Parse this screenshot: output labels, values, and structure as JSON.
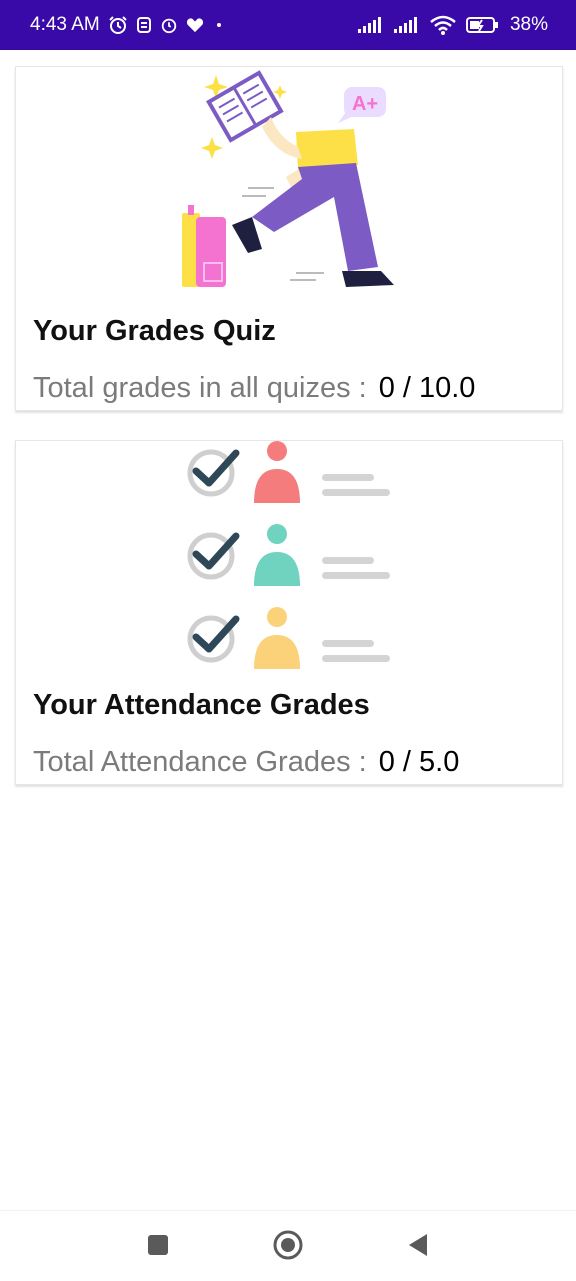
{
  "status_bar": {
    "time": "4:43 AM",
    "battery": "38%",
    "icons": [
      "alarm-icon",
      "notification-icon",
      "alarm-clock-icon",
      "heart-icon",
      "dot-icon",
      "signal-icon",
      "signal-icon",
      "wifi-icon",
      "battery-charging-icon"
    ]
  },
  "quiz_card": {
    "title": "Your Grades Quiz",
    "total_label": "Total grades in all quizes :",
    "total_value": "0 / 10.0",
    "illustration": "student-studying-illustration",
    "badge": "A+"
  },
  "attendance_card": {
    "title": "Your Attendance Grades",
    "total_label": "Total Attendance Grades :",
    "total_value": "0 / 5.0",
    "illustration": "attendance-checklist-illustration"
  },
  "nav_bar": {
    "buttons": [
      "recents-button",
      "home-button",
      "back-button"
    ]
  },
  "colors": {
    "status_bar": "#3a0aa8",
    "person_red": "#f47c7c",
    "person_teal": "#6fd3bf",
    "person_yellow": "#fbd17a",
    "check_dark": "#2f4858",
    "purple": "#7c5cc4",
    "yellow": "#fde047",
    "pink": "#f472d0"
  }
}
